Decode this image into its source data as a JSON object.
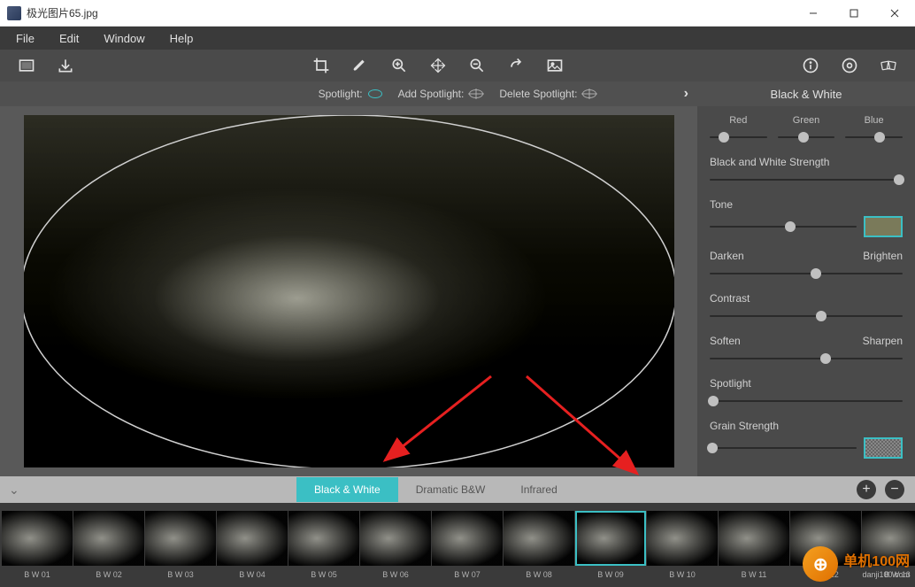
{
  "window": {
    "title": "极光图片65.jpg"
  },
  "menu": {
    "items": [
      "File",
      "Edit",
      "Window",
      "Help"
    ]
  },
  "optbar": {
    "spotlight": "Spotlight:",
    "add": "Add Spotlight:",
    "del": "Delete Spotlight:",
    "panel_title": "Black & White"
  },
  "panel": {
    "rgb": {
      "red": "Red",
      "green": "Green",
      "blue": "Blue",
      "rval": 25,
      "gval": 45,
      "bval": 60
    },
    "bw_strength": {
      "label": "Black and White Strength",
      "val": 98
    },
    "tone": {
      "label": "Tone",
      "val": 55
    },
    "darken_brighten": {
      "left": "Darken",
      "right": "Brighten",
      "val": 55
    },
    "contrast": {
      "label": "Contrast",
      "val": 58
    },
    "soften_sharpen": {
      "left": "Soften",
      "right": "Sharpen",
      "val": 60
    },
    "spotlight": {
      "label": "Spotlight",
      "val": 2
    },
    "grain": {
      "label": "Grain Strength",
      "val": 2
    }
  },
  "tabs": {
    "items": [
      "Black & White",
      "Dramatic B&W",
      "Infrared"
    ],
    "active": 0
  },
  "thumbs": [
    "B W 01",
    "B W 02",
    "B W 03",
    "B W 04",
    "B W 05",
    "B W 06",
    "B W 07",
    "B W 08",
    "B W 09",
    "B W 10",
    "B W 11",
    "B W 12",
    "B W 13"
  ],
  "selected_thumb": 8,
  "watermark": {
    "brand": "单机100网",
    "url": "danji100.com"
  }
}
